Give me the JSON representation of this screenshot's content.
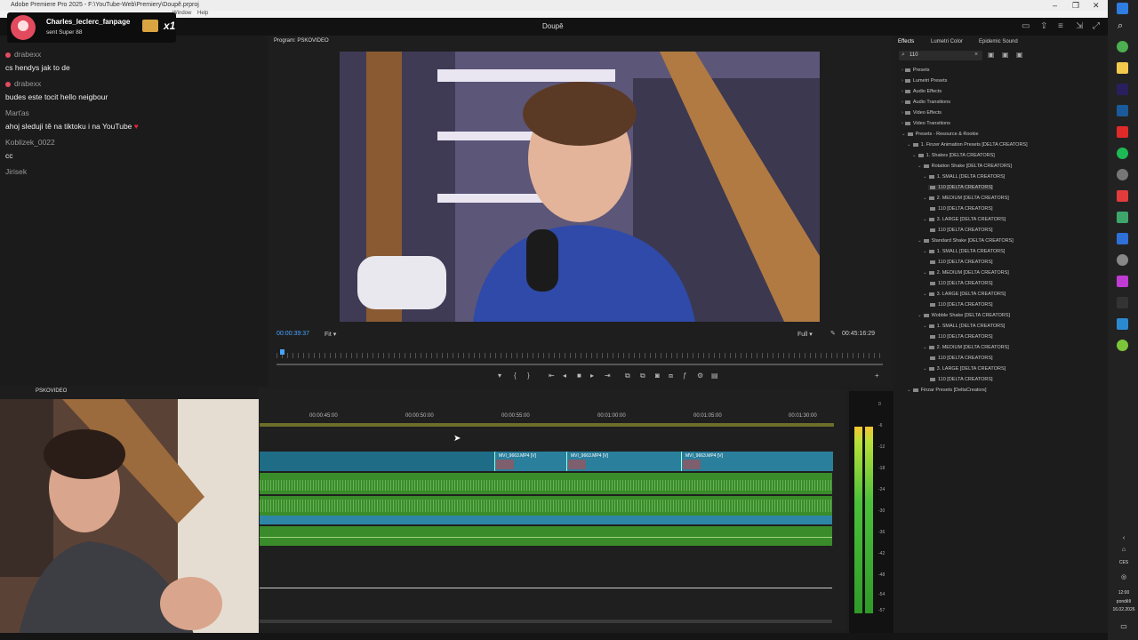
{
  "window": {
    "title": "Adobe Premiere Pro 2025 - F:\\YouTube-Web\\Premiery\\Doupě.prproj",
    "project_title": "Doupě",
    "menu_items": [
      "Window",
      "Help"
    ]
  },
  "chat": {
    "donation": {
      "name": "Charles_leclerc_fanpage",
      "text": "sent Super 88",
      "multiplier": "x1"
    },
    "messages": [
      {
        "user": "drabexx",
        "text": "cs hendys jak to de"
      },
      {
        "user": "drabexx",
        "text": "budes este tocit hello neigbour"
      },
      {
        "user": "Marťas",
        "text": "ahoj sleduji tě na tiktoku i na YouTube"
      },
      {
        "user": "Koblizek_0022",
        "text": "cc"
      },
      {
        "user": "Jirisek",
        "text": ""
      }
    ]
  },
  "program_monitor": {
    "tab_label": "Program: PSKOVIDEO",
    "current_timecode": "00:00:39:37",
    "fit_label": "Fit",
    "quality_label": "Full",
    "duration_timecode": "00:45:16:29"
  },
  "timeline": {
    "sequence_label": "PSKOVIDEO",
    "ruler_times": [
      "00:00:45:00",
      "00:00:50:00",
      "00:00:55:00",
      "00:01:00:00",
      "00:01:05:00",
      "00:01:30:00"
    ],
    "clips": [
      "MVI_9663.MP4 [V]",
      "MVI_9663.MP4 [V]",
      "MVI_9663.MP4 [V]"
    ]
  },
  "meter": {
    "labels": [
      "0",
      "-6",
      "-12",
      "-18",
      "-24",
      "-30",
      "-36",
      "-42",
      "-48",
      "-54",
      "-57"
    ]
  },
  "effects": {
    "tabs": [
      "Effects",
      "Lumetri Color",
      "Epidemic Sound"
    ],
    "search_value": "110",
    "tree": [
      {
        "label": "Presets",
        "level": 0
      },
      {
        "label": "Lumetri Presets",
        "level": 0
      },
      {
        "label": "Audio Effects",
        "level": 0
      },
      {
        "label": "Audio Transitions",
        "level": 0
      },
      {
        "label": "Video Effects",
        "level": 0
      },
      {
        "label": "Video Transitions",
        "level": 0
      },
      {
        "label": "Presets - Resource & Rookie",
        "level": 0
      },
      {
        "label": "1. Finzer Animation Presets [DELTA CREATORS]",
        "level": 1
      },
      {
        "label": "1. Shakes [DELTA CREATORS]",
        "level": 2
      },
      {
        "label": "Rotation Shake [DELTA CREATORS]",
        "level": 3
      },
      {
        "label": "1. SMALL [DELTA CREATORS]",
        "level": 4
      },
      {
        "label": "110 [DELTA CREATORS]",
        "level": 5
      },
      {
        "label": "2. MEDIUM [DELTA CREATORS]",
        "level": 4
      },
      {
        "label": "110 [DELTA CREATORS]",
        "level": 5
      },
      {
        "label": "3. LARGE [DELTA CREATORS]",
        "level": 4
      },
      {
        "label": "110 [DELTA CREATORS]",
        "level": 5
      },
      {
        "label": "Standard Shake [DELTA CREATORS]",
        "level": 3
      },
      {
        "label": "1. SMALL [DELTA CREATORS]",
        "level": 4
      },
      {
        "label": "110 [DELTA CREATORS]",
        "level": 5
      },
      {
        "label": "2. MEDIUM [DELTA CREATORS]",
        "level": 4
      },
      {
        "label": "110 [DELTA CREATORS]",
        "level": 5
      },
      {
        "label": "3. LARGE [DELTA CREATORS]",
        "level": 4
      },
      {
        "label": "110 [DELTA CREATORS]",
        "level": 5
      },
      {
        "label": "Wobble Shake [DELTA CREATORS]",
        "level": 3
      },
      {
        "label": "1. SMALL [DELTA CREATORS]",
        "level": 4
      },
      {
        "label": "110 [DELTA CREATORS]",
        "level": 5
      },
      {
        "label": "2. MEDIUM [DELTA CREATORS]",
        "level": 4
      },
      {
        "label": "110 [DELTA CREATORS]",
        "level": 5
      },
      {
        "label": "3. LARGE [DELTA CREATORS]",
        "level": 4
      },
      {
        "label": "110 [DELTA CREATORS]",
        "level": 5
      },
      {
        "label": "Finzar Presets [DeltaCreators]",
        "level": 1
      }
    ]
  },
  "taskbar": {
    "lang": "CES",
    "time": "12:00",
    "day": "pondělí",
    "date": "16.02.2026"
  },
  "colors": {
    "accent": "#2d8ceb",
    "video_clip": "#1e6c86",
    "audio_clip": "#3a8c2b",
    "timeline_ruler": "#d8d84a"
  }
}
